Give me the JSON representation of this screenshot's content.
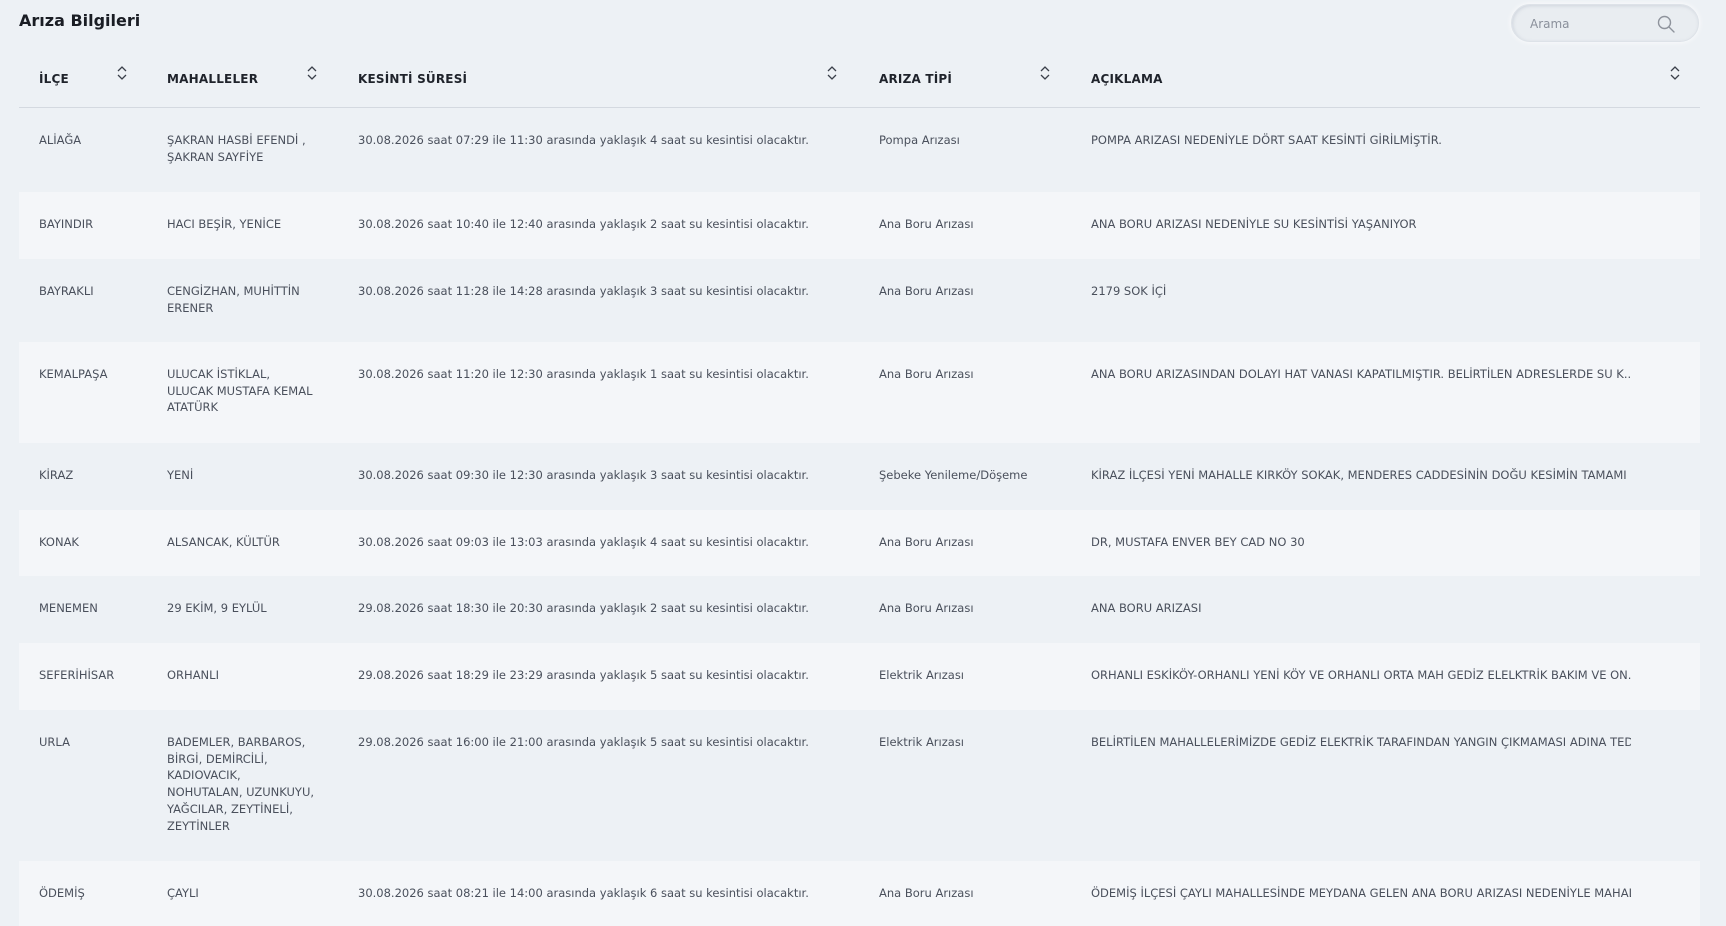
{
  "page_title": "Arıza Bilgileri",
  "search": {
    "placeholder": "Arama",
    "value": ""
  },
  "columns": [
    "İLÇE",
    "MAHALLELER",
    "KESİNTİ SÜRESİ",
    "ARIZA TİPİ",
    "AÇIKLAMA"
  ],
  "rows": [
    {
      "ilce": "ALİAĞA",
      "mahalleler": [
        "ŞAKRAN HASBİ EFENDİ ,",
        "ŞAKRAN SAYFİYE"
      ],
      "kesinti": "30.08.2026 saat 07:29 ile 11:30 arasında yaklaşık 4 saat su kesintisi olacaktır.",
      "tip": "Pompa Arızası",
      "aciklama": "POMPA ARIZASI NEDENİYLE DÖRT SAAT KESİNTİ GİRİLMİŞTİR."
    },
    {
      "ilce": "BAYINDIR",
      "mahalleler": [
        "HACI BEŞİR, YENİCE"
      ],
      "kesinti": "30.08.2026 saat 10:40 ile 12:40 arasında yaklaşık 2 saat su kesintisi olacaktır.",
      "tip": "Ana Boru Arızası",
      "aciklama": "ANA BORU ARIZASI NEDENİYLE SU KESİNTİSİ YAŞANIYOR"
    },
    {
      "ilce": "BAYRAKLI",
      "mahalleler": [
        "CENGİZHAN, MUHİTTİN",
        "ERENER"
      ],
      "kesinti": "30.08.2026 saat 11:28 ile 14:28 arasında yaklaşık 3 saat su kesintisi olacaktır.",
      "tip": "Ana Boru Arızası",
      "aciklama": "2179 SOK İÇİ"
    },
    {
      "ilce": "KEMALPAŞA",
      "mahalleler": [
        "ULUCAK İSTİKLAL,",
        "ULUCAK MUSTAFA KEMAL",
        "ATATÜRK"
      ],
      "kesinti": "30.08.2026 saat 11:20 ile 12:30 arasında yaklaşık 1 saat su kesintisi olacaktır.",
      "tip": "Ana Boru Arızası",
      "aciklama": "ANA BORU ARIZASINDAN DOLAYI HAT VANASI KAPATILMIŞTIR. BELİRTİLEN ADRESLERDE SU K..."
    },
    {
      "ilce": "KİRAZ",
      "mahalleler": [
        "YENİ"
      ],
      "kesinti": "30.08.2026 saat 09:30 ile 12:30 arasında yaklaşık 3 saat su kesintisi olacaktır.",
      "tip": "Şebeke Yenileme/Döşeme",
      "aciklama": "KİRAZ İLÇESİ YENİ MAHALLE KIRKÖY SOKAK, MENDERES CADDESİNİN DOĞU KESİMİN TAMAMI ..."
    },
    {
      "ilce": "KONAK",
      "mahalleler": [
        "ALSANCAK, KÜLTÜR"
      ],
      "kesinti": "30.08.2026 saat 09:03 ile 13:03 arasında yaklaşık 4 saat su kesintisi olacaktır.",
      "tip": "Ana Boru Arızası",
      "aciklama": "DR, MUSTAFA ENVER BEY CAD NO 30"
    },
    {
      "ilce": "MENEMEN",
      "mahalleler": [
        "29 EKİM, 9 EYLÜL"
      ],
      "kesinti": "29.08.2026 saat 18:30 ile 20:30 arasında yaklaşık 2 saat su kesintisi olacaktır.",
      "tip": "Ana Boru Arızası",
      "aciklama": "ANA BORU ARIZASI"
    },
    {
      "ilce": "SEFERİHİSAR",
      "mahalleler": [
        "ORHANLI"
      ],
      "kesinti": "29.08.2026 saat 18:29 ile 23:29 arasında yaklaşık 5 saat su kesintisi olacaktır.",
      "tip": "Elektrik Arızası",
      "aciklama": "ORHANLI ESKİKÖY-ORHANLI YENİ KÖY VE ORHANLI ORTA MAH GEDİZ ELELKTRİK BAKIM VE ON..."
    },
    {
      "ilce": "URLA",
      "mahalleler": [
        "BADEMLER, BARBAROS,",
        "BİRGİ, DEMİRCİLİ,",
        "KADIOVACIK,",
        "NOHUTALAN, UZUNKUYU,",
        "YAĞCILAR, ZEYTİNELİ,",
        "ZEYTİNLER"
      ],
      "kesinti": "29.08.2026 saat 16:00 ile 21:00 arasında yaklaşık 5 saat su kesintisi olacaktır.",
      "tip": "Elektrik Arızası",
      "aciklama": "BELİRTİLEN MAHALLELERİMİZDE GEDİZ ELEKTRİK TARAFINDAN YANGIN ÇIKMAMASI ADINA TED..."
    },
    {
      "ilce": "ÖDEMİŞ",
      "mahalleler": [
        "ÇAYLI"
      ],
      "kesinti": "30.08.2026 saat 08:21 ile 14:00 arasında yaklaşık 6 saat su kesintisi olacaktır.",
      "tip": "Ana Boru Arızası",
      "aciklama": "ÖDEMİŞ İLÇESİ ÇAYLI MAHALLESİNDE MEYDANA GELEN ANA BORU ARIZASI NEDENİYLE MAHALL..."
    }
  ]
}
